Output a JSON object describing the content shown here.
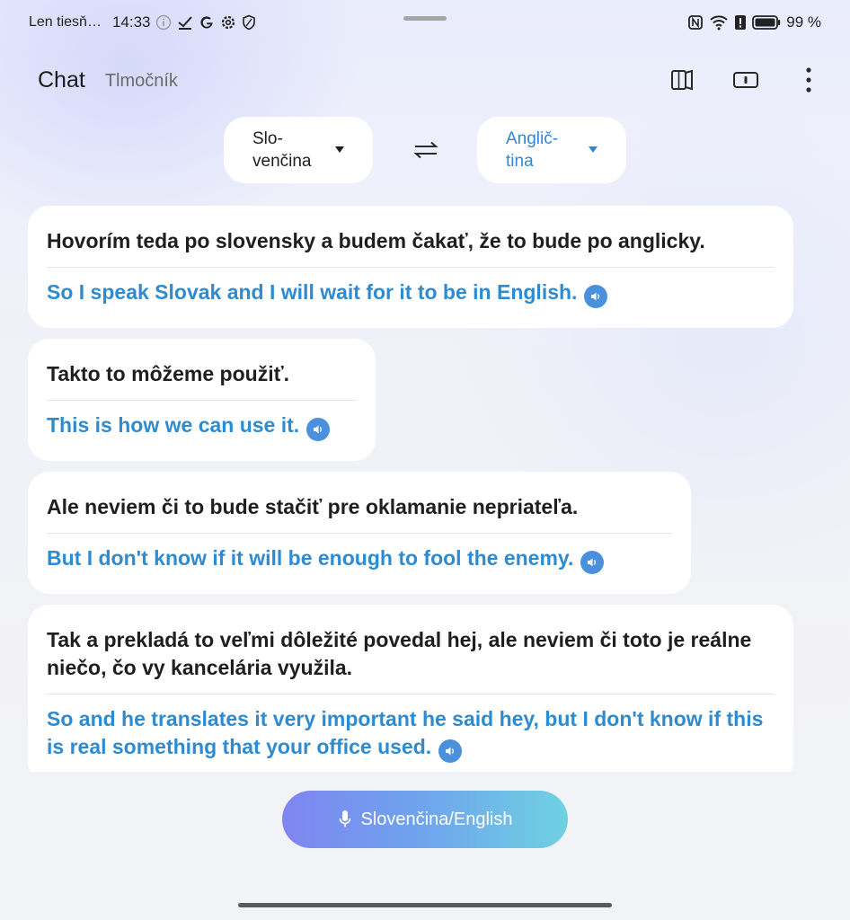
{
  "status_bar": {
    "carrier": "Len tiesň…",
    "time": "14:33",
    "battery": "99 %",
    "left_icons": [
      "info-icon",
      "check-icon",
      "google-icon",
      "settings-icon",
      "shield-icon"
    ],
    "right_icons": [
      "nfc-icon",
      "wifi-icon",
      "alert-icon",
      "battery-icon"
    ]
  },
  "app_bar": {
    "tab_chat": "Chat",
    "tab_interpreter": "Tlmočník",
    "actions": [
      "book-icon",
      "screen-icon",
      "more-vertical-icon"
    ]
  },
  "languages": {
    "source": "Slo-\nvenčina",
    "target": "Anglič-\ntina"
  },
  "messages": [
    {
      "original": "Hovorím teda po slovensky a budem čakať, že to bude po anglicky.",
      "translation": "So I speak Slovak and I will wait for it to be in English."
    },
    {
      "original": "Takto to môžeme použiť.",
      "translation": "This is how we can use it."
    },
    {
      "original": "Ale neviem či to bude stačiť pre oklamanie nepriateľa.",
      "translation": "But I don't know if it will be enough to fool the enemy."
    },
    {
      "original": "Tak a prekladá to veľmi dôležité povedal hej, ale neviem či toto je reálne niečo, čo vy kancelária využila.",
      "translation": "So and he translates it very important he said hey, but I don't know if this is real something that your office used."
    }
  ],
  "mic": {
    "label": "Slovenčina/English"
  },
  "colors": {
    "accent": "#2f8bd0",
    "mic_gradient_start": "#7f86f0",
    "mic_gradient_end": "#6fd1e2"
  }
}
